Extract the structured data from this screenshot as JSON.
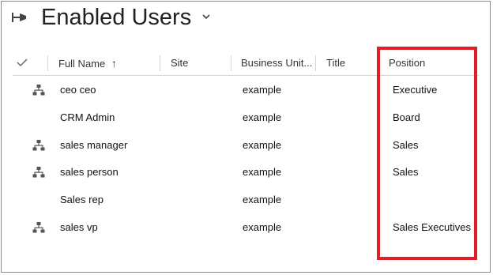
{
  "view": {
    "title": "Enabled Users",
    "colors": {
      "highlight": "#e01e26",
      "border": "#8a8a8a",
      "divider": "#d6d6d6"
    },
    "icons": {
      "pin": "pin-icon",
      "chevron": "chevron-down-icon",
      "check": "checkmark-icon",
      "hierarchy": "hierarchy-icon",
      "sort": "arrow-up-icon"
    }
  },
  "columns": {
    "full_name": "Full Name",
    "sort_arrow": "↑",
    "site": "Site",
    "business_unit": "Business Unit...",
    "title": "Title",
    "position": "Position"
  },
  "rows": [
    {
      "hierarchy": true,
      "full_name": "ceo ceo",
      "business_unit": "example",
      "position": "Executive"
    },
    {
      "hierarchy": false,
      "full_name": "CRM Admin",
      "business_unit": "example",
      "position": "Board"
    },
    {
      "hierarchy": true,
      "full_name": "sales manager",
      "business_unit": "example",
      "position": "Sales"
    },
    {
      "hierarchy": true,
      "full_name": "sales person",
      "business_unit": "example",
      "position": "Sales"
    },
    {
      "hierarchy": false,
      "full_name": "Sales rep",
      "business_unit": "example",
      "position": ""
    },
    {
      "hierarchy": true,
      "full_name": "sales vp",
      "business_unit": "example",
      "position": "Sales Executives"
    }
  ]
}
